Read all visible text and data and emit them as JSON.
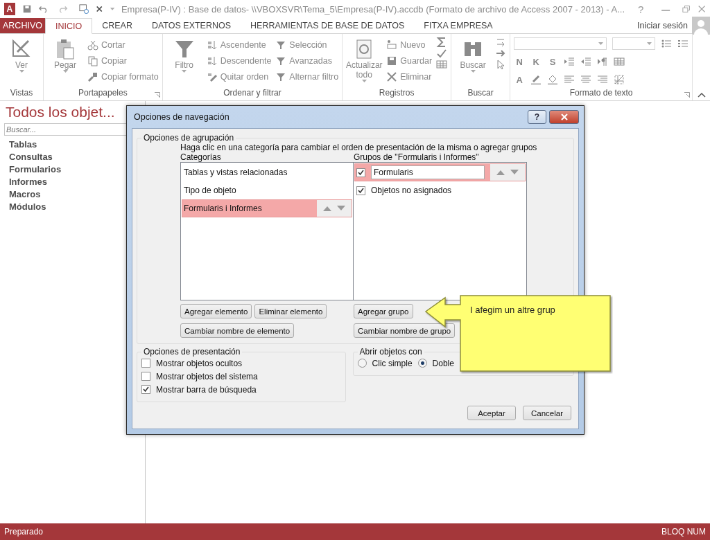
{
  "title_bar": {
    "app_logo": "A",
    "title": "Empresa(P-IV) : Base de datos- \\\\VBOXSVR\\Tema_5\\Empresa(P-IV).accdb (Formato de archivo de Access 2007 - 2013) - A...",
    "help": "?"
  },
  "ribbon_tabs": [
    {
      "label": "ARCHIVO",
      "kind": "file",
      "selected": false
    },
    {
      "label": "INICIO",
      "kind": "tab",
      "selected": true
    },
    {
      "label": "CREAR",
      "kind": "tab",
      "selected": false
    },
    {
      "label": "DATOS EXTERNOS",
      "kind": "tab",
      "selected": false
    },
    {
      "label": "HERRAMIENTAS DE BASE DE DATOS",
      "kind": "tab",
      "selected": false
    },
    {
      "label": "FITXA EMPRESA",
      "kind": "tab",
      "selected": false
    }
  ],
  "account": {
    "label": "Iniciar sesión"
  },
  "ribbon_groups": [
    {
      "label": "Vistas",
      "columns": [
        [
          {
            "label": "Ver",
            "kind": "large"
          }
        ]
      ]
    },
    {
      "label": "Portapapeles",
      "launcher": true,
      "columns": [
        [
          {
            "label": "Pegar",
            "kind": "large"
          }
        ],
        [
          {
            "label": "Cortar",
            "kind": "small"
          },
          {
            "label": "Copiar",
            "kind": "small"
          },
          {
            "label": "Copiar formato",
            "kind": "small"
          }
        ]
      ]
    },
    {
      "label": "Ordenar y filtrar",
      "columns": [
        [
          {
            "label": "Filtro",
            "kind": "large"
          }
        ],
        [
          {
            "label": "Ascendente",
            "kind": "small"
          },
          {
            "label": "Descendente",
            "kind": "small"
          },
          {
            "label": "Quitar orden",
            "kind": "small"
          }
        ],
        [
          {
            "label": "Selección",
            "kind": "small"
          },
          {
            "label": "Avanzadas",
            "kind": "small"
          },
          {
            "label": "Alternar filtro",
            "kind": "small"
          }
        ]
      ]
    },
    {
      "label": "Registros",
      "columns": [
        [
          {
            "label": "Actualizar todo",
            "kind": "large"
          }
        ],
        [
          {
            "label": "Nuevo",
            "kind": "small"
          },
          {
            "label": "Guardar",
            "kind": "small"
          },
          {
            "label": "Eliminar",
            "kind": "small"
          }
        ],
        [
          {
            "kind": "icon"
          },
          {
            "kind": "icon"
          },
          {
            "kind": "icon"
          }
        ]
      ]
    },
    {
      "label": "Buscar",
      "columns": [
        [
          {
            "label": "Buscar",
            "kind": "large"
          }
        ],
        [
          {
            "kind": "icon"
          },
          {
            "kind": "icon"
          },
          {
            "kind": "icon"
          }
        ]
      ]
    },
    {
      "label": "Formato de texto",
      "launcher": true,
      "rows": [
        [
          {
            "kind": "combo"
          },
          {
            "kind": "combo"
          },
          {
            "kind": "icon"
          },
          {
            "kind": "icon"
          }
        ],
        [
          {
            "label": "N",
            "kind": "letter"
          },
          {
            "label": "K",
            "kind": "letter"
          },
          {
            "label": "S",
            "kind": "letter"
          },
          {
            "kind": "icon"
          },
          {
            "kind": "icon"
          },
          {
            "kind": "icon"
          },
          {
            "kind": "icon"
          }
        ],
        [
          {
            "label": "A",
            "kind": "letter"
          },
          {
            "kind": "icon"
          },
          {
            "kind": "icon"
          },
          {
            "kind": "icon"
          },
          {
            "kind": "icon"
          },
          {
            "kind": "icon"
          },
          {
            "kind": "icon"
          }
        ]
      ]
    }
  ],
  "nav_pane": {
    "title": "Todos los objet...",
    "search": {
      "placeholder": "Buscar..."
    },
    "items": [
      "Tablas",
      "Consultas",
      "Formularios",
      "Informes",
      "Macros",
      "Módulos"
    ]
  },
  "dialog": {
    "title": "Opciones de navegación",
    "help": "?",
    "grouping": {
      "legend": "Opciones de agrupación",
      "instruction": "Haga clic en una categoría para cambiar el orden de presentación de la misma o agregar grupos",
      "categories_label": "Categorías",
      "groups_label": "Grupos de \"Formularis i Informes\"",
      "categories": [
        {
          "label": "Tablas y vistas relacionadas",
          "selected": false
        },
        {
          "label": "Tipo de objeto",
          "selected": false
        },
        {
          "label": "Formularis i Informes",
          "selected": true
        }
      ],
      "groups": [
        {
          "label": "Formularis",
          "checked": true,
          "selected": true
        },
        {
          "label": "Objetos no asignados",
          "checked": true,
          "selected": false
        }
      ],
      "category_buttons": [
        [
          "Agregar elemento",
          "Eliminar elemento"
        ],
        [
          "Cambiar nombre de elemento"
        ]
      ],
      "group_buttons": [
        [
          "Agregar grupo"
        ],
        [
          "Cambiar nombre de grupo"
        ]
      ]
    },
    "display": {
      "legend": "Opciones de presentación",
      "options": [
        {
          "label": "Mostrar objetos ocultos",
          "checked": false
        },
        {
          "label": "Mostrar objetos del sistema",
          "checked": false
        },
        {
          "label": "Mostrar barra de búsqueda",
          "checked": true
        }
      ]
    },
    "open_with": {
      "legend": "Abrir objetos con",
      "options": [
        {
          "label": "Clic simple",
          "selected": false
        },
        {
          "label": "Doble",
          "selected": true
        }
      ]
    },
    "buttons": [
      "Aceptar",
      "Cancelar"
    ]
  },
  "callout": {
    "text": "I afegim un altre grup"
  },
  "status_bar": {
    "left": "Preparado",
    "right": "BLOQ NUM"
  }
}
